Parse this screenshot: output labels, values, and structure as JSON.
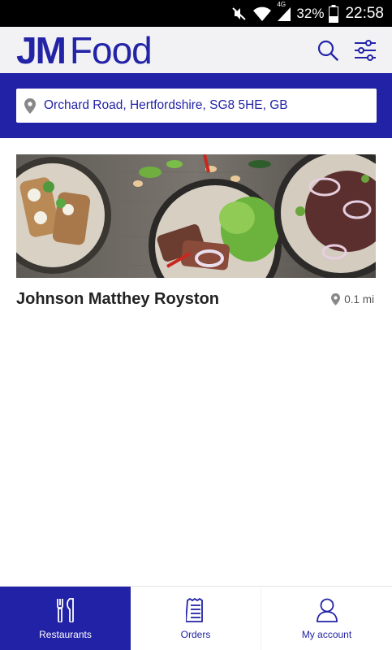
{
  "status_bar": {
    "battery": "32%",
    "time": "22:58",
    "network": "4G",
    "icons": [
      "mute-icon",
      "wifi-icon",
      "signal-icon",
      "battery-icon"
    ]
  },
  "header": {
    "logo_part1": "JM",
    "logo_part2": "Food",
    "icons": [
      "search-icon",
      "filter-icon"
    ],
    "brand_color": "#2323a8"
  },
  "location": {
    "address": "Orchard Road, Hertfordshire, SG8 5HE, GB",
    "icon": "map-pin-icon",
    "band_color": "#2222a6"
  },
  "restaurants": [
    {
      "name": "Johnson Matthey Royston",
      "distance": "0.1 mi"
    }
  ],
  "bottom_nav": {
    "items": [
      {
        "label": "Restaurants",
        "icon": "cutlery-icon",
        "active": true
      },
      {
        "label": "Orders",
        "icon": "receipt-icon",
        "active": false
      },
      {
        "label": "My account",
        "icon": "user-icon",
        "active": false
      }
    ]
  }
}
